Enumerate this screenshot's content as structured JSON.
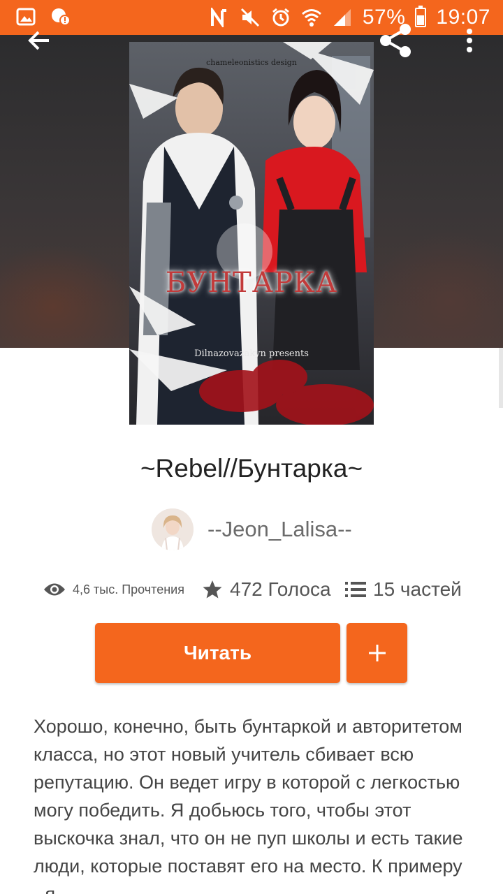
{
  "status_bar": {
    "battery": "57%",
    "time": "19:07",
    "battery_level": 0.57
  },
  "cover": {
    "title": "БУНТАРКА",
    "credit": "chameleonistics design",
    "presents": "Dilnazovazakyn presents"
  },
  "story": {
    "title": "~Rebel//Бунтарка~",
    "author": "--Jeon_Lalisa--",
    "reads": "4,6 тыс. Прочтения",
    "votes": "472 Голоса",
    "parts": "15 частей",
    "description": "Хорошо, конечно, быть бунтаркой и авторитетом класса, но этот новый учитель сбивает всю репутацию. Он ведет игру в которой с легкостью могу победить. Я добьюсь того, чтобы этот выскочка знал, что он не пуп школы и есть такие люди, которые поставят его на место. К примеру - я."
  },
  "actions": {
    "read_label": "Читать"
  },
  "icons": {
    "back": "back-arrow-icon",
    "share": "share-icon",
    "more": "more-vert-icon",
    "reads": "eye-icon",
    "votes": "star-icon",
    "parts": "list-icon",
    "add": "plus-icon"
  },
  "colors": {
    "accent": "#f4661d"
  }
}
